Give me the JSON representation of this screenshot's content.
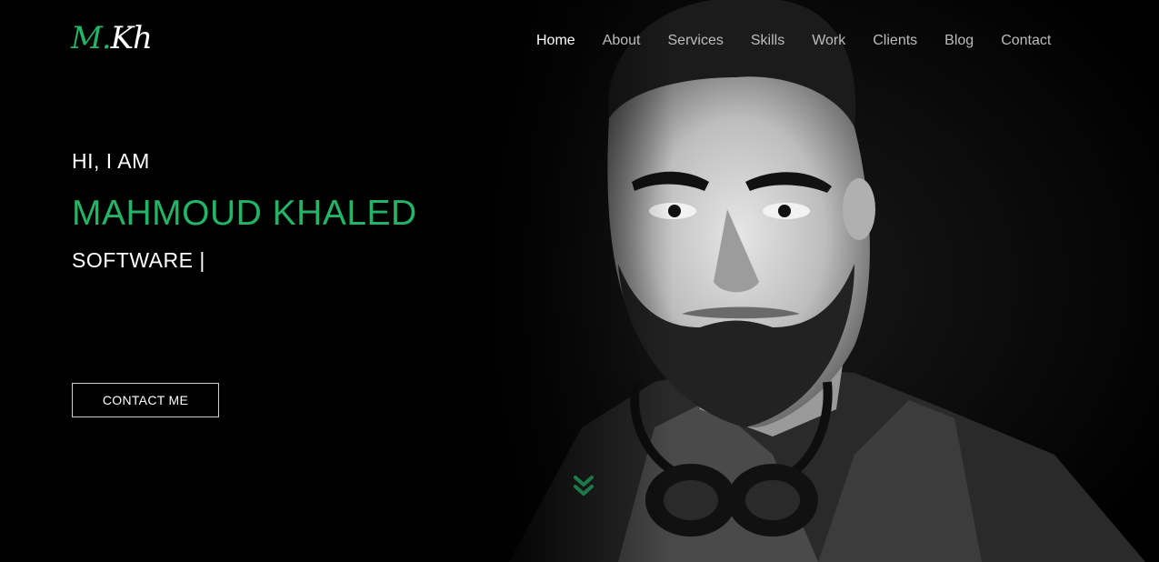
{
  "logo": {
    "part1": "M.",
    "part2": "Kh"
  },
  "nav": {
    "items": [
      {
        "label": "Home",
        "active": true
      },
      {
        "label": "About"
      },
      {
        "label": "Services"
      },
      {
        "label": "Skills"
      },
      {
        "label": "Work"
      },
      {
        "label": "Clients"
      },
      {
        "label": "Blog"
      },
      {
        "label": "Contact"
      }
    ]
  },
  "hero": {
    "greeting": "HI, I AM",
    "name": "MAHMOUD KHALED",
    "role": "SOFTWARE |",
    "cta_label": "CONTACT ME",
    "scroll_icon": "chevron-double-down-icon",
    "portrait": "portrait-photo"
  },
  "colors": {
    "accent": "#22b567",
    "background": "#000000",
    "nav_text": "#bdbdbd",
    "nav_active": "#ffffff"
  }
}
